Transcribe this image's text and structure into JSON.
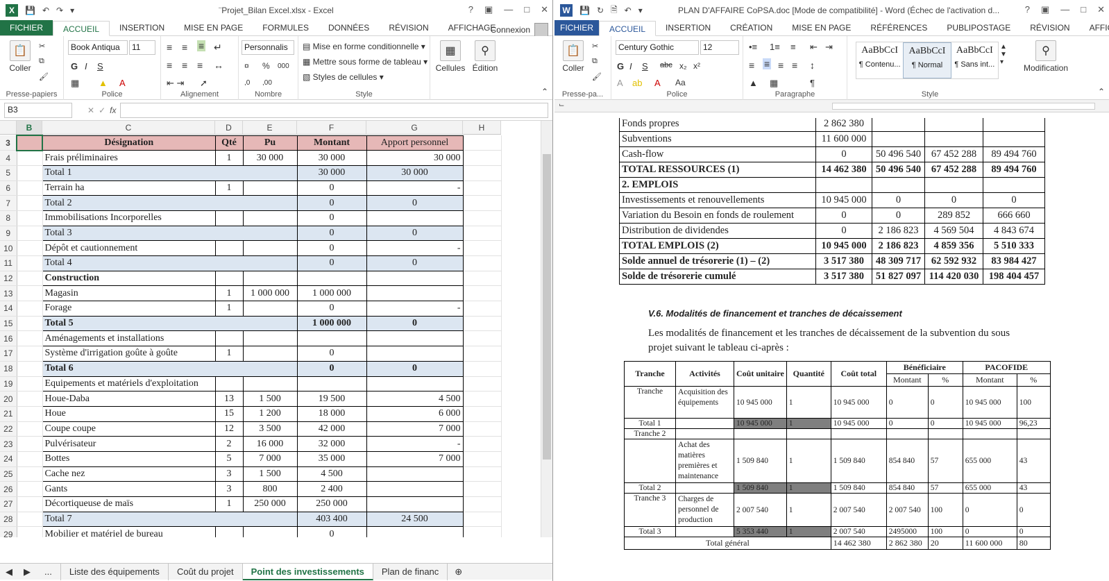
{
  "excel": {
    "title": "¨Projet_Bilan Excel.xlsx - Excel",
    "app_badge": "X",
    "help": "?",
    "tabs": [
      "FICHIER",
      "ACCUEIL",
      "INSERTION",
      "MISE EN PAGE",
      "FORMULES",
      "DONNÉES",
      "RÉVISION",
      "AFFICHAGE"
    ],
    "signin": "Connexion",
    "ribbon": {
      "paste": "Coller",
      "font_name": "Book Antiqua",
      "font_size": "11",
      "number_format": "Personnalis",
      "conditional": "Mise en forme conditionnelle",
      "table_format": "Mettre sous forme de tableau",
      "cell_styles": "Styles de cellules",
      "cells": "Cellules",
      "edit": "Édition",
      "groups": [
        "Presse-papiers",
        "Police",
        "Alignement",
        "Nombre",
        "Style"
      ]
    },
    "name_box": "B3",
    "formula": "",
    "columns": [
      "B",
      "C",
      "D",
      "E",
      "F",
      "G",
      "H"
    ],
    "header": {
      "row": "3",
      "designation": "Désignation",
      "qte": "Qté",
      "pu": "Pu",
      "montant": "Montant",
      "apport": "Apport personnel"
    },
    "rows": [
      {
        "n": "4",
        "d": "Frais préliminaires",
        "q": "1",
        "pu": "30 000",
        "m": "30 000",
        "a": "30 000",
        "type": "item"
      },
      {
        "n": "5",
        "d": "Total 1",
        "q": "",
        "pu": "",
        "m": "30 000",
        "a": "30 000",
        "type": "total"
      },
      {
        "n": "6",
        "d": "Terrain ha",
        "q": "1",
        "pu": "",
        "m": "0",
        "a": "-",
        "type": "item"
      },
      {
        "n": "7",
        "d": "Total 2",
        "q": "",
        "pu": "",
        "m": "0",
        "a": "0",
        "type": "total"
      },
      {
        "n": "8",
        "d": "Immobilisations Incorporelles",
        "q": "",
        "pu": "",
        "m": "0",
        "a": "",
        "type": "item"
      },
      {
        "n": "9",
        "d": "Total 3",
        "q": "",
        "pu": "",
        "m": "0",
        "a": "0",
        "type": "total"
      },
      {
        "n": "10",
        "d": "Dépôt et cautionnement",
        "q": "",
        "pu": "",
        "m": "0",
        "a": "-",
        "type": "item"
      },
      {
        "n": "11",
        "d": "Total 4",
        "q": "",
        "pu": "",
        "m": "0",
        "a": "0",
        "type": "total"
      },
      {
        "n": "12",
        "d": "Construction",
        "q": "",
        "pu": "",
        "m": "",
        "a": "",
        "type": "section"
      },
      {
        "n": "13",
        "d": "Magasin",
        "q": "1",
        "pu": "1 000 000",
        "m": "1 000 000",
        "a": "",
        "type": "item"
      },
      {
        "n": "14",
        "d": "Forage",
        "q": "1",
        "pu": "",
        "m": "0",
        "a": "-",
        "type": "item"
      },
      {
        "n": "15",
        "d": "Total 5",
        "q": "",
        "pu": "",
        "m": "1 000 000",
        "a": "0",
        "type": "totalb"
      },
      {
        "n": "16",
        "d": "Aménagements et installations",
        "q": "",
        "pu": "",
        "m": "",
        "a": "",
        "type": "item"
      },
      {
        "n": "17",
        "d": "Système d'irrigation goûte à goûte",
        "q": "1",
        "pu": "",
        "m": "0",
        "a": "",
        "type": "item"
      },
      {
        "n": "18",
        "d": "Total 6",
        "q": "",
        "pu": "",
        "m": "0",
        "a": "0",
        "type": "totalb"
      },
      {
        "n": "19",
        "d": "Equipements et matériels d'exploitation",
        "q": "",
        "pu": "",
        "m": "",
        "a": "",
        "type": "item"
      },
      {
        "n": "20",
        "d": "Houe-Daba",
        "q": "13",
        "pu": "1 500",
        "m": "19 500",
        "a": "4 500",
        "type": "item"
      },
      {
        "n": "21",
        "d": "Houe",
        "q": "15",
        "pu": "1 200",
        "m": "18 000",
        "a": "6 000",
        "type": "item"
      },
      {
        "n": "22",
        "d": "Coupe coupe",
        "q": "12",
        "pu": "3 500",
        "m": "42 000",
        "a": "7 000",
        "type": "item"
      },
      {
        "n": "23",
        "d": "Pulvérisateur",
        "q": "2",
        "pu": "16 000",
        "m": "32 000",
        "a": "-",
        "type": "item"
      },
      {
        "n": "24",
        "d": "Bottes",
        "q": "5",
        "pu": "7 000",
        "m": "35 000",
        "a": "7 000",
        "type": "item"
      },
      {
        "n": "25",
        "d": "Cache nez",
        "q": "3",
        "pu": "1 500",
        "m": "4 500",
        "a": "",
        "type": "item"
      },
      {
        "n": "26",
        "d": "Gants",
        "q": "3",
        "pu": "800",
        "m": "2 400",
        "a": "",
        "type": "item"
      },
      {
        "n": "27",
        "d": "Décortiqueuse de maïs",
        "q": "1",
        "pu": "250 000",
        "m": "250 000",
        "a": "",
        "type": "item"
      },
      {
        "n": "28",
        "d": "Total 7",
        "q": "",
        "pu": "",
        "m": "403 400",
        "a": "24 500",
        "type": "total"
      },
      {
        "n": "29",
        "d": "Mobilier et matériel de bureau",
        "q": "",
        "pu": "",
        "m": "0",
        "a": "",
        "type": "item"
      }
    ],
    "sheet_tabs": [
      "...",
      "Liste des équipements",
      "Coût du projet",
      "Point des investissements",
      "Plan de financ"
    ],
    "active_sheet": "Point des investissements"
  },
  "word": {
    "title": "PLAN D'AFFAIRE CoPSA.doc [Mode de compatibilité] - Word (Échec de l'activation d...",
    "app_badge": "W",
    "help": "?",
    "tabs": [
      "FICHIER",
      "ACCUEIL",
      "INSERTION",
      "CRÉATION",
      "MISE EN PAGE",
      "RÉFÉRENCES",
      "PUBLIPOSTAGE",
      "RÉVISION",
      "AFFICHAGE"
    ],
    "ribbon": {
      "paste": "Coller",
      "font_name": "Century Gothic",
      "font_size": "12",
      "styles": [
        {
          "sample": "AaBbCcI",
          "name": "¶ Contenu..."
        },
        {
          "sample": "AaBbCcI",
          "name": "¶ Normal"
        },
        {
          "sample": "AaBbCcI",
          "name": "¶ Sans int..."
        }
      ],
      "modification": "Modification",
      "groups": [
        "Presse-pa...",
        "Police",
        "Paragraphe",
        "Style"
      ]
    },
    "table1": [
      {
        "label": "Fonds propres",
        "v": [
          "2 862 380",
          "",
          "",
          ""
        ],
        "bold": false
      },
      {
        "label": "Subventions",
        "v": [
          "11 600 000",
          "",
          "",
          ""
        ],
        "bold": false
      },
      {
        "label": "Cash-flow",
        "v": [
          "0",
          "50 496 540",
          "67 452 288",
          "89 494 760"
        ],
        "bold": false
      },
      {
        "label": "TOTAL RESSOURCES (1)",
        "v": [
          "14 462 380",
          "50 496 540",
          "67 452 288",
          "89 494 760"
        ],
        "bold": true
      },
      {
        "label": "2. EMPLOIS",
        "v": [
          "",
          "",
          "",
          ""
        ],
        "bold": true
      },
      {
        "label": "Investissements et renouvellements",
        "v": [
          "10 945 000",
          "0",
          "0",
          "0"
        ],
        "bold": false
      },
      {
        "label": "Variation du Besoin en fonds de roulement",
        "v": [
          "0",
          "0",
          "289 852",
          "666 660"
        ],
        "bold": false
      },
      {
        "label": "Distribution de dividendes",
        "v": [
          "0",
          "2 186 823",
          "4 569 504",
          "4 843 674"
        ],
        "bold": false
      },
      {
        "label": "TOTAL EMPLOIS (2)",
        "v": [
          "10 945 000",
          "2 186 823",
          "4 859 356",
          "5 510 333"
        ],
        "bold": true
      },
      {
        "label": "Solde annuel de trésorerie (1) – (2)",
        "v": [
          "3 517 380",
          "48 309 717",
          "62 592 932",
          "83 984 427"
        ],
        "bold": true
      },
      {
        "label": "Solde de trésorerie cumulé",
        "v": [
          "3 517 380",
          "51 827 097",
          "114 420 030",
          "198 404 457"
        ],
        "bold": true
      }
    ],
    "heading": "V.6. Modalités de financement et tranches de décaissement",
    "paragraph": "Les modalités de financement et les tranches de décaissement de la subvention du sous projet suivant le tableau ci-après :",
    "table2": {
      "headers": [
        "Tranche",
        "Activités",
        "Coût unitaire",
        "Quantité",
        "Coût total",
        "Bénéficiaire",
        "PACOFIDE"
      ],
      "sub": [
        "Montant",
        "%",
        "Montant",
        "%"
      ],
      "rows": [
        [
          "Tranche",
          "Acquisition des équipements",
          "10 945 000",
          "1",
          "10 945 000",
          "0",
          "0",
          "10 945 000",
          "100"
        ],
        [
          "Total 1",
          "",
          "10 945 000",
          "1",
          "10 945 000",
          "0",
          "0",
          "10 945 000",
          "96,23"
        ],
        [
          "Tranche 2",
          "",
          "",
          "",
          "",
          "",
          "",
          "",
          ""
        ],
        [
          "",
          "Achat des matières premières et maintenance",
          "1 509 840",
          "1",
          "1 509 840",
          "854 840",
          "57",
          "655 000",
          "43"
        ],
        [
          "Total 2",
          "",
          "1 509 840",
          "1",
          "1 509 840",
          "854 840",
          "57",
          "655 000",
          "43"
        ],
        [
          "Tranche 3",
          "Charges de personnel de production",
          "2 007 540",
          "1",
          "2 007 540",
          "2 007 540",
          "100",
          "0",
          "0"
        ],
        [
          "Total 3",
          "",
          "5 353 440",
          "1",
          "2 007 540",
          "2495000",
          "100",
          "0",
          "0"
        ],
        [
          "Total général",
          "",
          "",
          "",
          "14 462 380",
          "2 862 380",
          "20",
          "11 600 000",
          "80"
        ]
      ]
    }
  }
}
